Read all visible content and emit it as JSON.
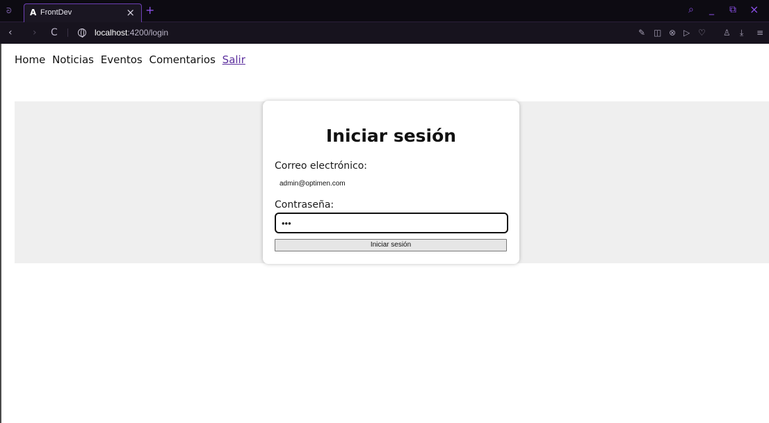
{
  "browser": {
    "tab": {
      "title": "FrontDev",
      "favicon": "A",
      "close": "×"
    },
    "new_tab": "+",
    "address": {
      "host": "localhost",
      "path": ":4200/login"
    },
    "window_controls": {
      "search": "⌕",
      "minimize": "_",
      "maximize": "⧉",
      "close": "×"
    },
    "nav": {
      "back": "‹",
      "forward": "›",
      "reload": "C"
    },
    "toolbar_icons": [
      "edit-icon",
      "camera-icon",
      "block-icon",
      "send-icon",
      "heart-icon",
      "profile-icon",
      "download-icon",
      "menu-icon"
    ],
    "accent": "#8a4fe6"
  },
  "nav": {
    "items": [
      "Home",
      "Noticias",
      "Eventos",
      "Comentarios"
    ],
    "logout": "Salir"
  },
  "login": {
    "title": "Iniciar sesión",
    "email_label": "Correo electrónico:",
    "email_value": "admin@optimen.com",
    "password_label": "Contraseña:",
    "password_value": "•••",
    "submit_label": "Iniciar sesión"
  }
}
